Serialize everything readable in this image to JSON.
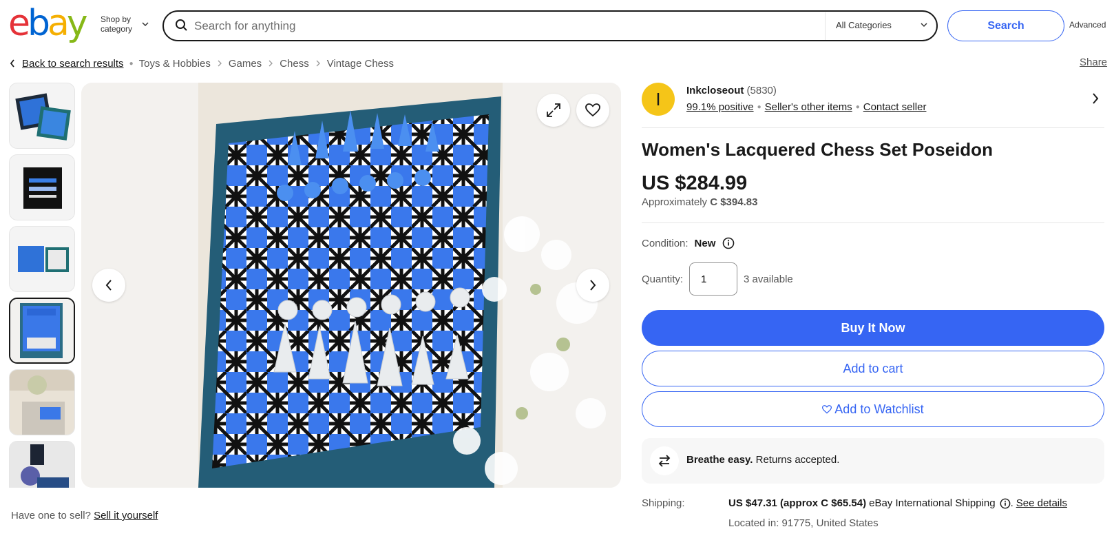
{
  "header": {
    "logo_text": "ebay",
    "shop_by_line1": "Shop by",
    "shop_by_line2": "category",
    "search_placeholder": "Search for anything",
    "category_selected": "All Categories",
    "search_button": "Search",
    "advanced": "Advanced"
  },
  "breadcrumb": {
    "back": "Back to search results",
    "items": [
      "Toys & Hobbies",
      "Games",
      "Chess",
      "Vintage Chess"
    ],
    "share": "Share"
  },
  "gallery": {
    "thumbnail_count": 6,
    "selected_index": 3
  },
  "sell_line": {
    "text": "Have one to sell?",
    "link": "Sell it yourself"
  },
  "seller": {
    "initial": "I",
    "name": "Inkcloseout",
    "feedback_count": "(5830)",
    "positive": "99.1% positive",
    "other_items": "Seller's other items",
    "contact": "Contact seller"
  },
  "listing": {
    "title": "Women's Lacquered Chess Set Poseidon",
    "price": "US $284.99",
    "approx_label": "Approximately",
    "approx_value": "C $394.83",
    "condition_label": "Condition:",
    "condition_value": "New",
    "quantity_label": "Quantity:",
    "quantity_value": "1",
    "available": "3 available"
  },
  "actions": {
    "buy_now": "Buy It Now",
    "add_to_cart": "Add to cart",
    "add_to_watchlist": "Add to Watchlist"
  },
  "returns": {
    "bold": "Breathe easy.",
    "text": "Returns accepted."
  },
  "shipping": {
    "label": "Shipping:",
    "cost": "US $47.31 (approx C $65.54)",
    "service": "eBay International Shipping",
    "details": "See details",
    "location": "Located in: 91775, United States"
  },
  "colors": {
    "primary": "#3665f3",
    "logo_e": "#e53238",
    "logo_b": "#0064d2",
    "logo_a": "#f5af02",
    "logo_y": "#86b817",
    "avatar": "#f5c518"
  }
}
